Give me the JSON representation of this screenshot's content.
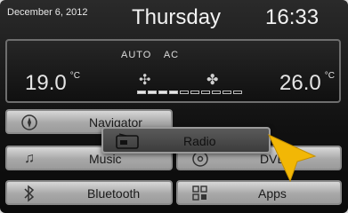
{
  "header": {
    "date": "December 6, 2012",
    "day": "Thursday",
    "time": "16:33"
  },
  "climate": {
    "mode_auto": "AUTO",
    "mode_ac": "AC",
    "temp_left": "19.0",
    "temp_right": "26.0",
    "unit": "°C",
    "fan_level_fraction": 0.4
  },
  "menu": {
    "navigator": "Navigator",
    "music": "Music",
    "bluetooth": "Bluetooth",
    "dvd": "DVD",
    "apps": "Apps",
    "radio": "Radio"
  },
  "colors": {
    "pointer": "#f2b705"
  }
}
